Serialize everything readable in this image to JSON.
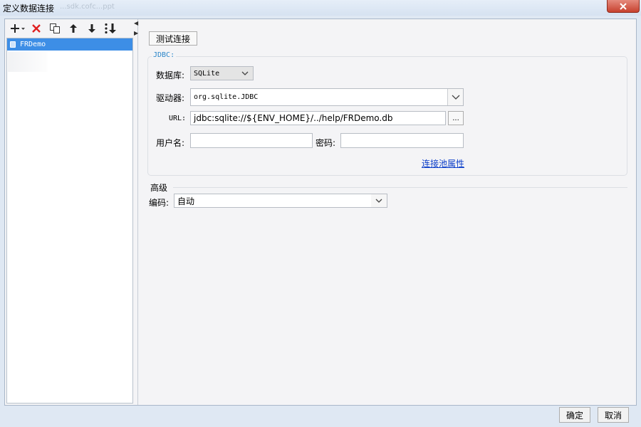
{
  "window": {
    "title": "定义数据连接",
    "ghost_text": "...sdk.cofc...ppt"
  },
  "tree": {
    "items": [
      {
        "label": "FRDemo",
        "selected": true
      },
      {
        "label": ""
      },
      {
        "label": ""
      }
    ]
  },
  "toolbar": {
    "add_icon": "plus-dropdown-icon",
    "delete_icon": "red-x-icon",
    "copy_icon": "copy-icon",
    "up_icon": "arrow-up-icon",
    "down_icon": "arrow-down-icon",
    "sort_icon": "sort-icon"
  },
  "main": {
    "test_button": "测试连接",
    "jdbc_legend": "JDBC:",
    "database_label": "数据库:",
    "database_value": "SQLite",
    "driver_label": "驱动器:",
    "driver_value": "org.sqlite.JDBC",
    "url_label": "URL:",
    "url_value": "jdbc:sqlite://${ENV_HOME}/../help/FRDemo.db",
    "url_browse": "...",
    "username_label": "用户名:",
    "username_value": "",
    "password_label": "密码:",
    "password_value": "",
    "pool_link": "连接池属性",
    "advanced_title": "高级",
    "encoding_label": "编码:",
    "encoding_value": "自动"
  },
  "footer": {
    "ok_button": "确定",
    "cancel_button": "取消"
  },
  "colors": {
    "selection": "#3d8ee6",
    "link": "#0b3ec9",
    "legend": "#2b86c9",
    "close_button": "#c7412e"
  }
}
